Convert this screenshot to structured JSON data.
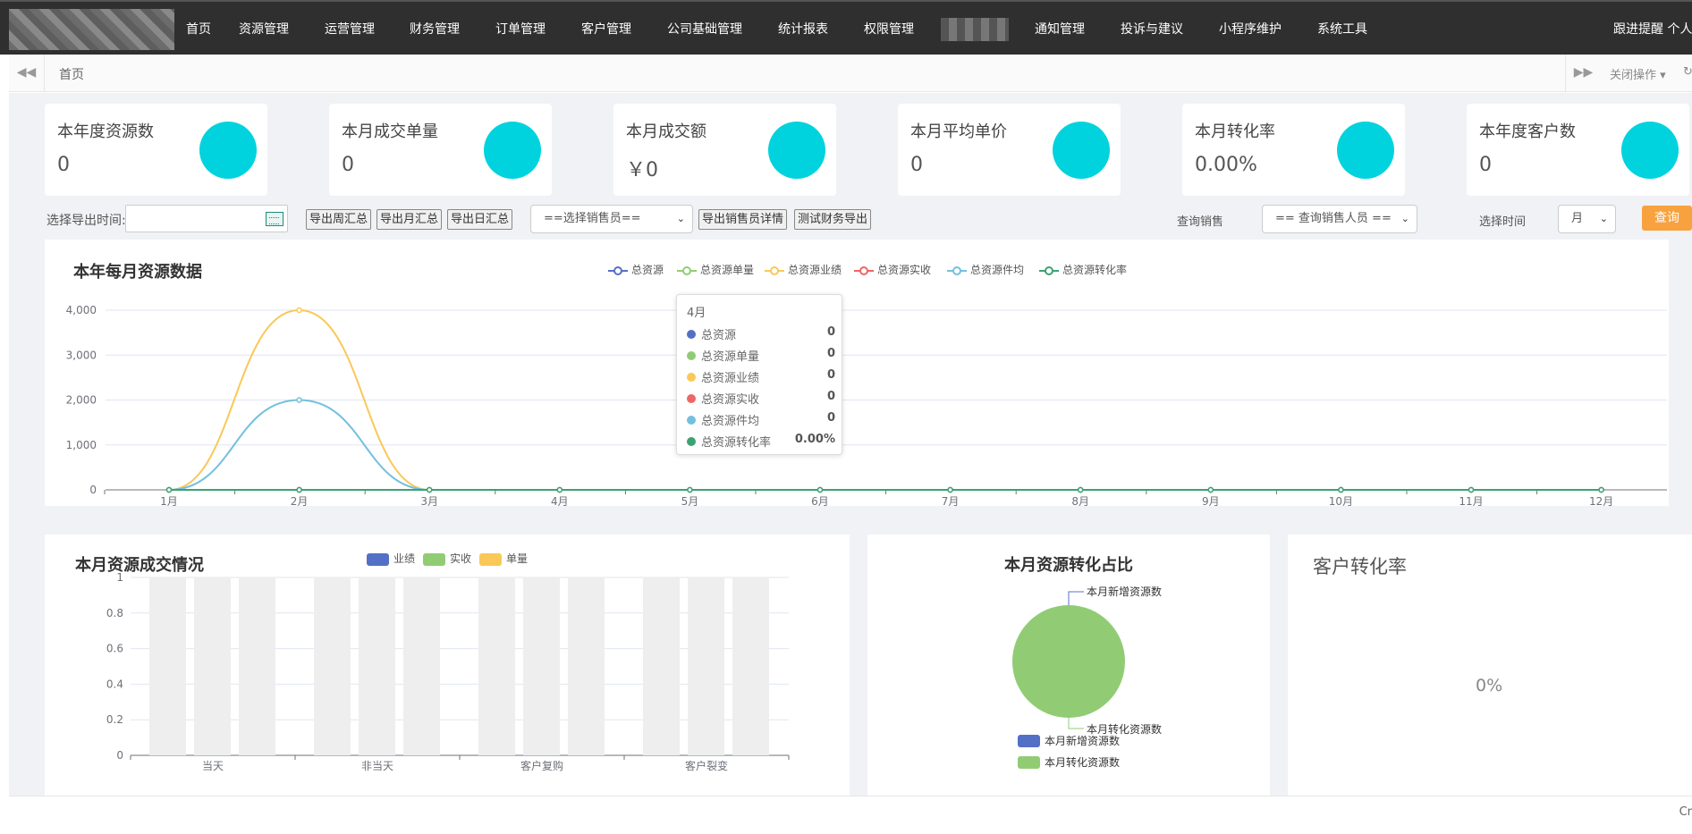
{
  "nav": {
    "items": [
      {
        "label": "首页",
        "left": 208
      },
      {
        "label": "资源管理",
        "left": 267
      },
      {
        "label": "运营管理",
        "left": 363
      },
      {
        "label": "财务管理",
        "left": 458
      },
      {
        "label": "订单管理",
        "left": 554
      },
      {
        "label": "客户管理",
        "left": 650
      },
      {
        "label": "公司基础管理",
        "left": 746
      },
      {
        "label": "统计报表",
        "left": 870
      },
      {
        "label": "权限管理",
        "left": 966
      },
      {
        "label": "通知管理",
        "left": 1157
      },
      {
        "label": "投诉与建议",
        "left": 1253
      },
      {
        "label": "小程序维护",
        "left": 1363
      },
      {
        "label": "系统工具",
        "left": 1473
      }
    ],
    "right_text": "跟进提醒 个人"
  },
  "subbar": {
    "home": "首页",
    "close_ops": "关闭操作"
  },
  "stats": [
    {
      "title": "本年度资源数",
      "value": "0"
    },
    {
      "title": "本月成交单量",
      "value": "0"
    },
    {
      "title": "本月成交额",
      "value": "￥0"
    },
    {
      "title": "本月平均单价",
      "value": "0"
    },
    {
      "title": "本月转化率",
      "value": "0.00%"
    },
    {
      "title": "本年度客户数",
      "value": "0"
    }
  ],
  "filters": {
    "export_time_label": "选择导出时间:",
    "export_time_value": "",
    "btn_week": "导出周汇总",
    "btn_month": "导出月汇总",
    "btn_day": "导出日汇总",
    "salesperson_select": "==选择销售员==",
    "btn_salesperson_detail": "导出销售员详情",
    "btn_finance_test": "测试财务导出",
    "query_sales_label": "查询销售",
    "query_sales_select": "== 查询销售人员 ==",
    "select_time_label": "选择时间",
    "time_select": "月",
    "query_button": "查询"
  },
  "chart_data": [
    {
      "type": "line",
      "title": "本年每月资源数据",
      "categories": [
        "1月",
        "2月",
        "3月",
        "4月",
        "5月",
        "6月",
        "7月",
        "8月",
        "9月",
        "10月",
        "11月",
        "12月"
      ],
      "ylim": [
        0,
        4000
      ],
      "yticks": [
        "0",
        "1,000",
        "2,000",
        "3,000",
        "4,000"
      ],
      "legend_position": "top",
      "series": [
        {
          "name": "总资源",
          "color": "#5470c6",
          "values": [
            0,
            0,
            0,
            0,
            0,
            0,
            0,
            0,
            0,
            0,
            0,
            0
          ]
        },
        {
          "name": "总资源单量",
          "color": "#91cc75",
          "values": [
            0,
            0,
            0,
            0,
            0,
            0,
            0,
            0,
            0,
            0,
            0,
            0
          ]
        },
        {
          "name": "总资源业绩",
          "color": "#fac858",
          "values": [
            0,
            4000,
            0,
            0,
            0,
            0,
            0,
            0,
            0,
            0,
            0,
            0
          ]
        },
        {
          "name": "总资源实收",
          "color": "#ee6666",
          "values": [
            0,
            0,
            0,
            0,
            0,
            0,
            0,
            0,
            0,
            0,
            0,
            0
          ]
        },
        {
          "name": "总资源件均",
          "color": "#73c0de",
          "values": [
            0,
            2000,
            0,
            0,
            0,
            0,
            0,
            0,
            0,
            0,
            0,
            0
          ]
        },
        {
          "name": "总资源转化率",
          "color": "#3ba272",
          "values": [
            0,
            0,
            0,
            0,
            0,
            0,
            0,
            0,
            0,
            0,
            0,
            0
          ]
        }
      ],
      "tooltip": {
        "title": "4月",
        "rows": [
          {
            "name": "总资源",
            "value": "0",
            "color": "#5470c6"
          },
          {
            "name": "总资源单量",
            "value": "0",
            "color": "#91cc75"
          },
          {
            "name": "总资源业绩",
            "value": "0",
            "color": "#fac858"
          },
          {
            "name": "总资源实收",
            "value": "0",
            "color": "#ee6666"
          },
          {
            "name": "总资源件均",
            "value": "0",
            "color": "#73c0de"
          },
          {
            "name": "总资源转化率",
            "value": "0.00%",
            "color": "#3ba272"
          }
        ]
      }
    },
    {
      "type": "bar",
      "title": "本月资源成交情况",
      "categories": [
        "当天",
        "非当天",
        "客户复购",
        "客户裂变"
      ],
      "ylim": [
        0,
        1
      ],
      "yticks": [
        "0",
        "0.2",
        "0.4",
        "0.6",
        "0.8",
        "1"
      ],
      "legend_position": "top",
      "series": [
        {
          "name": "业绩",
          "color": "#5470c6",
          "values": [
            0,
            0,
            0,
            0
          ]
        },
        {
          "name": "实收",
          "color": "#91cc75",
          "values": [
            0,
            0,
            0,
            0
          ]
        },
        {
          "name": "单量",
          "color": "#fac858",
          "values": [
            0,
            0,
            0,
            0
          ]
        }
      ]
    },
    {
      "type": "pie",
      "title": "本月资源转化占比",
      "legend_position": "bottom",
      "slices": [
        {
          "name": "本月新增资源数",
          "value": 0,
          "color": "#5470c6"
        },
        {
          "name": "本月转化资源数",
          "value": 0,
          "color": "#91cc75"
        }
      ]
    }
  ],
  "conversion": {
    "title": "客户转化率",
    "value": "0%"
  },
  "footer": {
    "text": "Cr"
  }
}
